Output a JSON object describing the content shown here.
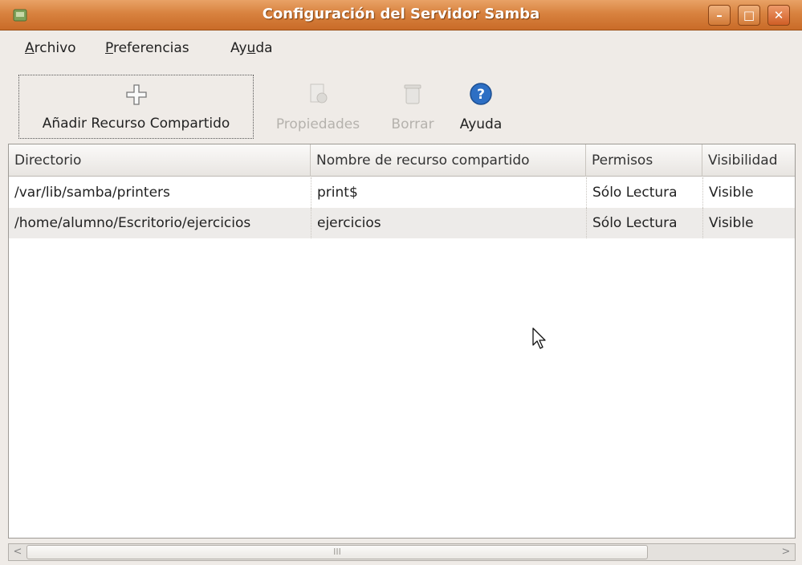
{
  "window": {
    "title": "Configuración del Servidor Samba"
  },
  "menubar": {
    "items": [
      {
        "mnemonic": "A",
        "rest": "rchivo"
      },
      {
        "mnemonic": "P",
        "rest": "referencias"
      },
      {
        "pre": "Ay",
        "mnemonic": "u",
        "rest": "da"
      }
    ]
  },
  "toolbar": {
    "add_label": "Añadir Recurso Compartido",
    "properties_label": "Propiedades",
    "delete_label": "Borrar",
    "help_label": "Ayuda"
  },
  "table": {
    "columns": [
      "Directorio",
      "Nombre de recurso compartido",
      "Permisos",
      "Visibilidad"
    ],
    "rows": [
      [
        "/var/lib/samba/printers",
        "print$",
        "Sólo Lectura",
        "Visible"
      ],
      [
        "/home/alumno/Escritorio/ejercicios",
        "ejercicios",
        "Sólo Lectura",
        "Visible"
      ]
    ]
  },
  "scrollbar": {
    "thumb_grip": "III",
    "left_arrow": "<",
    "right_arrow": ">"
  },
  "colors": {
    "titlebar": "#d8823f",
    "window_bg": "#efebe7",
    "help_icon": "#2d6fc4"
  },
  "icons": {
    "app": "samba-app-icon",
    "add": "plus-icon",
    "properties": "properties-icon",
    "delete": "trash-icon",
    "help": "help-icon"
  }
}
